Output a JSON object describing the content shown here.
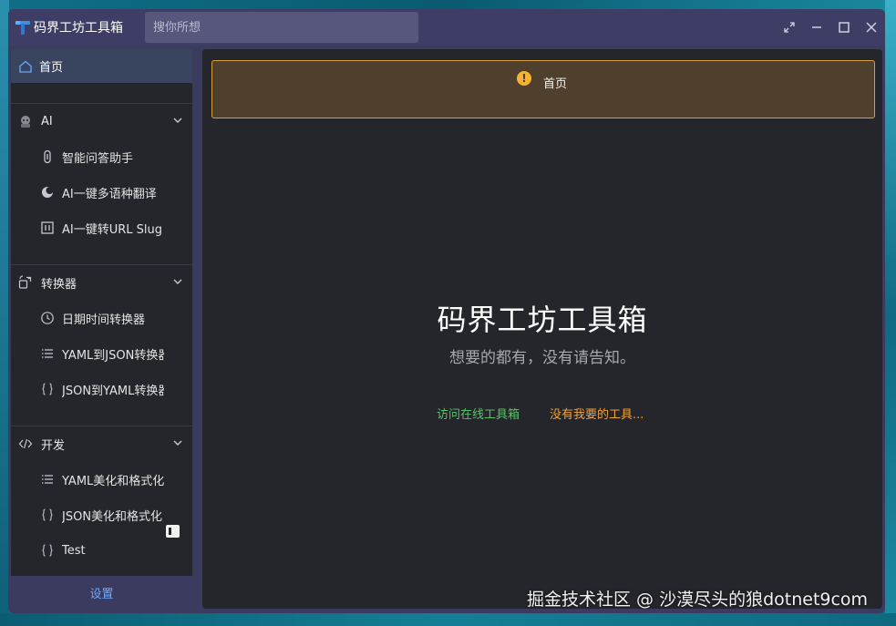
{
  "window": {
    "title": "码界工坊工具箱",
    "search_placeholder": "搜你所想"
  },
  "sidebar": {
    "home": "首页",
    "groups": [
      {
        "label": "AI",
        "items": [
          "智能问答助手",
          "AI一键多语种翻译",
          "AI一键转URL Slug"
        ]
      },
      {
        "label": "转换器",
        "items": [
          "日期时间转换器",
          "YAML到JSON转换器",
          "JSON到YAML转换器"
        ]
      },
      {
        "label": "开发",
        "items": [
          "YAML美化和格式化",
          "JSON美化和格式化",
          "Test"
        ]
      }
    ],
    "settings": "设置"
  },
  "main": {
    "alert_text": "首页",
    "hero_title": "码界工坊工具箱",
    "hero_subtitle": "想要的都有，没有请告知。",
    "link_online": "访问在线工具箱",
    "link_request": "没有我要的工具..."
  },
  "watermark": "掘金技术社区 @ 沙漠尽头的狼dotnet9com",
  "colors": {
    "accent_blue": "#6aa8ff",
    "warning": "#f5b237",
    "link_green": "#5cc06a",
    "link_orange": "#f0a23c"
  }
}
